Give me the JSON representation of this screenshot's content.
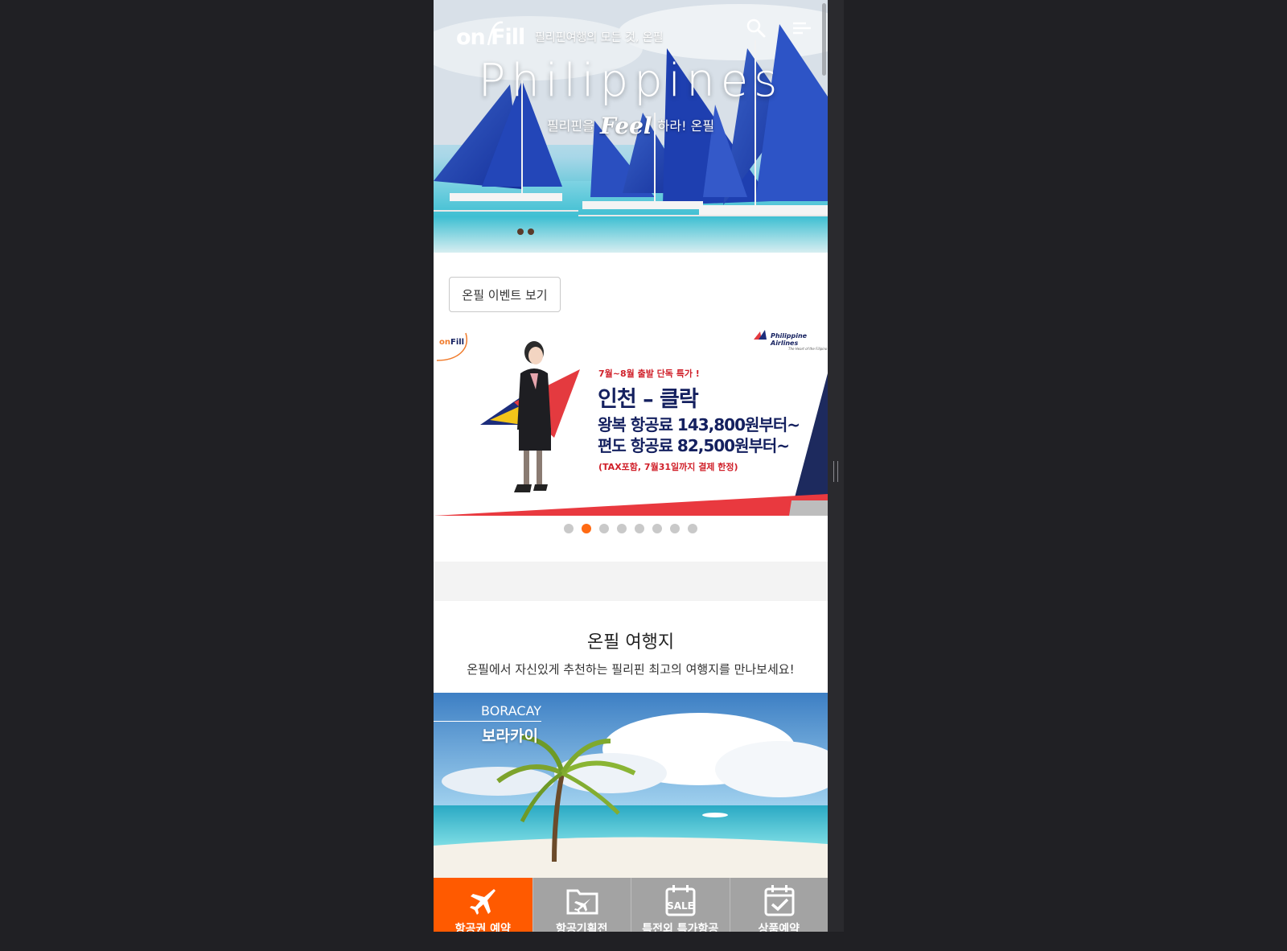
{
  "header": {
    "logo_text": "on Fill",
    "tagline": "필리핀여행의 모든 것, 온필",
    "search_icon": "search-icon",
    "menu_icon": "menu-icon"
  },
  "hero": {
    "title": "Philippines",
    "subtitle_before": "필리핀을",
    "subtitle_feel": "Feel",
    "subtitle_after": "하라! 온필"
  },
  "event_button_label": "온필 이벤트 보기",
  "banner": {
    "airline": "Philippine Airlines",
    "airline_tagline": "The Heart of the Filipino",
    "promo_small": "7월~8월 출발 단독 특가 !",
    "route": "인천 – 클락",
    "roundtrip": "왕복 항공료 143,800원부터~",
    "oneway": "편도 항공료 82,500원부터~",
    "note": "(TAX포함, 7월31일까지 결제 한정)",
    "slide_count": 8,
    "active_slide": 2
  },
  "destinations": {
    "title": "온필 여행지",
    "subtitle": "온필에서 자신있게 추천하는 필리핀 최고의 여행지를 만나보세요!",
    "items": [
      {
        "name_en": "BORACAY",
        "name_ko": "보라카이"
      }
    ]
  },
  "bottom_nav": [
    {
      "label": "항공권 예약",
      "icon": "airplane-icon",
      "active": true
    },
    {
      "label": "항공기획전",
      "icon": "folder-plane-icon",
      "active": false
    },
    {
      "label": "특전외 특가항공",
      "icon": "sale-calendar-icon",
      "active": false
    },
    {
      "label": "상품예약",
      "icon": "check-calendar-icon",
      "active": false
    }
  ],
  "colors": {
    "accent": "#ff5a00",
    "dot_active": "#ff6a13",
    "banner_navy": "#14205f",
    "banner_red": "#d0202a"
  }
}
